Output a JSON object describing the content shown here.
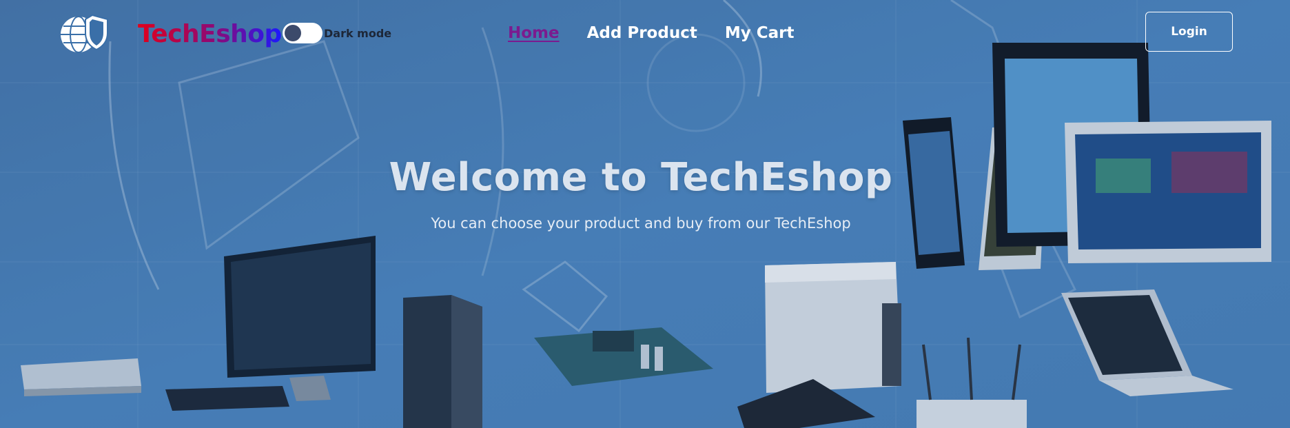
{
  "navbar": {
    "brand": "TechEshop",
    "logo_text": "TechEshop",
    "dark_mode_label": "Dark mode",
    "dark_mode_on": false,
    "links": [
      {
        "label": "Home",
        "active": true
      },
      {
        "label": "Add Product",
        "active": false
      },
      {
        "label": "My Cart",
        "active": false
      }
    ],
    "login_label": "Login"
  },
  "hero": {
    "title": "Welcome to TechEshop",
    "subtitle": "You can choose your product and buy from our TechEshop"
  },
  "colors": {
    "background_blue": "#4c86c0",
    "active_link": "#7b1b8f",
    "brand_gradient_start": "#e0001b",
    "brand_gradient_end": "#1a1aff"
  },
  "icons": {
    "logo": "globe-shield-icon",
    "toggle": "dark-mode-toggle"
  }
}
